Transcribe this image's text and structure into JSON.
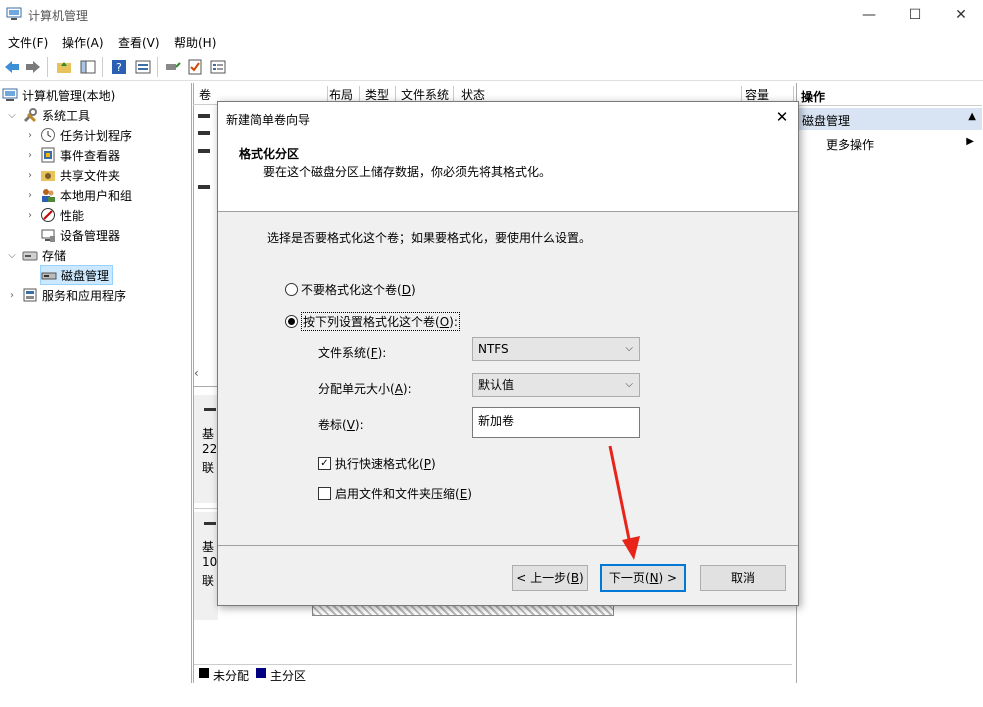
{
  "window": {
    "title": "计算机管理",
    "minimize": "—",
    "maximize": "☐",
    "close": "✕"
  },
  "menu": [
    {
      "label": "文件(F)"
    },
    {
      "label": "操作(A)"
    },
    {
      "label": "查看(V)"
    },
    {
      "label": "帮助(H)"
    }
  ],
  "tree": {
    "root": "计算机管理(本地)",
    "system_tools": "系统工具",
    "task_scheduler": "任务计划程序",
    "event_viewer": "事件查看器",
    "shared_folders": "共享文件夹",
    "local_users": "本地用户和组",
    "performance": "性能",
    "device_manager": "设备管理器",
    "storage": "存储",
    "disk_management": "磁盘管理",
    "services_apps": "服务和应用程序"
  },
  "volume_columns": [
    "卷",
    "布局",
    "类型",
    "文件系统",
    "状态",
    "容量"
  ],
  "disk_rows": [
    {
      "line1": "基",
      "line2": "22",
      "line3": "联"
    },
    {
      "line1": "基",
      "line2": "10",
      "line3": "联"
    }
  ],
  "legend": {
    "unallocated": "未分配",
    "primary": "主分区"
  },
  "actions": {
    "header": "操作",
    "section": "磁盘管理",
    "more": "更多操作"
  },
  "dialog": {
    "title": "新建简单卷向导",
    "heading": "格式化分区",
    "subheading": "要在这个磁盘分区上储存数据，你必须先将其格式化。",
    "question": "选择是否要格式化这个卷；如果要格式化，要使用什么设置。",
    "opt_no_format": "不要格式化这个卷(",
    "opt_no_format_key": "D",
    "opt_format": "按下列设置格式化这个卷(",
    "opt_format_key": "O",
    "fs_label": "文件系统(",
    "fs_key": "F",
    "fs_value": "NTFS",
    "alloc_label": "分配单元大小(",
    "alloc_key": "A",
    "alloc_value": "默认值",
    "vol_label": "卷标(",
    "vol_key": "V",
    "vol_value": "新加卷",
    "quick_format": "执行快速格式化(",
    "quick_key": "P",
    "quick_checked": true,
    "compress": "启用文件和文件夹压缩(",
    "compress_key": "E",
    "compress_checked": false,
    "back": "< 上一步(",
    "back_key": "B",
    "next": "下一页(",
    "next_key": "N",
    "cancel": "取消"
  },
  "colors": {
    "accent": "#0078d7",
    "annotation_arrow": "#e8231a",
    "selected_bg": "#cce8ff",
    "action_header_bg": "#d8e4f3"
  }
}
